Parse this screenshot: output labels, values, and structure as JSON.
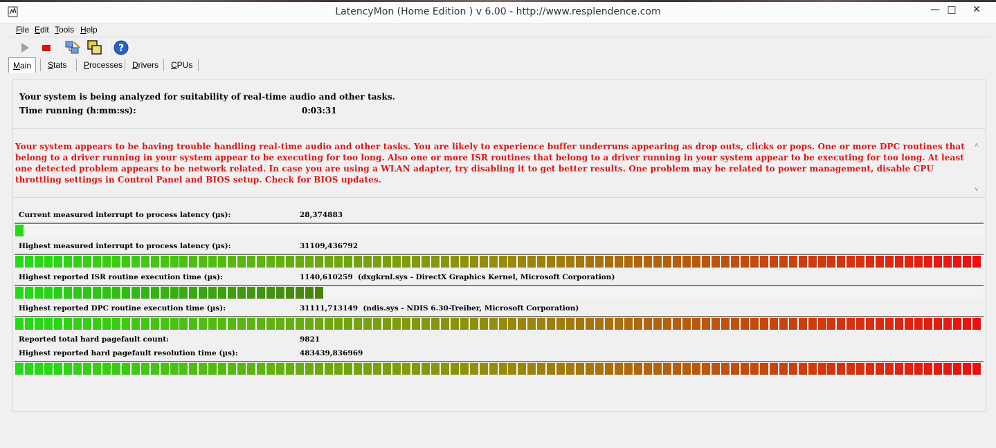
{
  "window": {
    "title": "LatencyMon  (Home Edition )  v 6.00 - http://www.resplendence.com",
    "minimize_glyph": "—",
    "maximize_glyph": "□",
    "close_glyph": "✕"
  },
  "menu": [
    {
      "key": "F",
      "rest": "ile"
    },
    {
      "key": "E",
      "rest": "dit"
    },
    {
      "key": "T",
      "rest": "ools"
    },
    {
      "key": "H",
      "rest": "elp"
    }
  ],
  "toolbar": {
    "icons": [
      "play-icon",
      "stop-icon",
      "network-icon",
      "windows-icon",
      "help-icon"
    ]
  },
  "tabs": [
    {
      "key": "M",
      "rest": "ain",
      "active": true
    },
    {
      "key": "S",
      "rest": "tats",
      "active": false
    },
    {
      "key": "P",
      "rest": "rocesses",
      "active": false
    },
    {
      "key": "D",
      "rest": "rivers",
      "active": false
    },
    {
      "key": "C",
      "rest": "PUs",
      "active": false
    }
  ],
  "status": {
    "analyzing_text": "Your system is being analyzed for suitability of real-time audio and other tasks.",
    "time_running_label": "Time running (h:mm:ss):",
    "time_running_value": "0:03:31"
  },
  "warning": {
    "text": "Your system appears to be having trouble handling real-time audio and other tasks. You are likely to experience buffer underruns appearing as drop outs, clicks or pops. One or more DPC routines that belong to a driver running in your system appear to be executing for too long. Also one or more ISR routines that belong to a driver running in your system appear to be executing for too long. At least one detected problem appears to be network related. In case you are using a WLAN adapter, try disabling it to get better results. One problem may be related to power management, disable CPU throttling settings in Control Panel and BIOS setup. Check for BIOS updates.",
    "color": "#e01414"
  },
  "metrics": {
    "current_latency": {
      "label": "Current measured interrupt to process latency (µs):",
      "value": "28,374883",
      "level": 0.01
    },
    "highest_latency": {
      "label": "Highest measured interrupt to process latency (µs):",
      "value": "31109,436792",
      "level": 1.0
    },
    "highest_isr": {
      "label": "Highest reported ISR routine execution time (µs):",
      "value": "1140,610259  (dxgkrnl.sys - DirectX Graphics Kernel, Microsoft Corporation)",
      "level": 0.32
    },
    "highest_dpc": {
      "label": "Highest reported DPC routine execution time (µs):",
      "value": "31111,713149  (ndis.sys - NDIS 6.30-Treiber, Microsoft Corporation)",
      "level": 1.0
    },
    "pagefault_count": {
      "label": "Reported total hard pagefault count:",
      "value": "9821"
    },
    "pagefault_time": {
      "label": "Highest reported hard pagefault resolution time (µs):",
      "value": "483439,836969",
      "level": 1.0
    }
  },
  "colors": {
    "bar_green": "#22dd14",
    "bar_red": "#ee1010",
    "bar_dark_green": "#4a8010"
  }
}
